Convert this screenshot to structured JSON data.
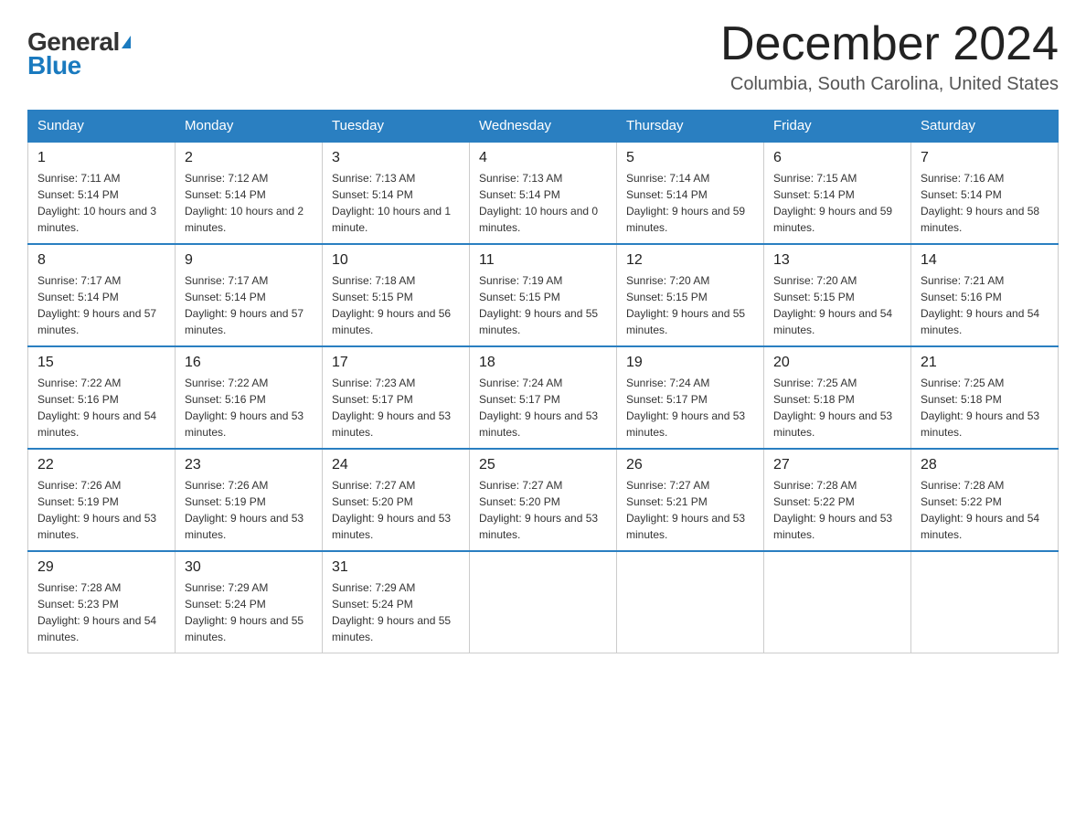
{
  "logo": {
    "general": "General",
    "blue": "Blue"
  },
  "header": {
    "title": "December 2024",
    "subtitle": "Columbia, South Carolina, United States"
  },
  "days_of_week": [
    "Sunday",
    "Monday",
    "Tuesday",
    "Wednesday",
    "Thursday",
    "Friday",
    "Saturday"
  ],
  "weeks": [
    [
      {
        "day": "1",
        "sunrise": "7:11 AM",
        "sunset": "5:14 PM",
        "daylight": "10 hours and 3 minutes."
      },
      {
        "day": "2",
        "sunrise": "7:12 AM",
        "sunset": "5:14 PM",
        "daylight": "10 hours and 2 minutes."
      },
      {
        "day": "3",
        "sunrise": "7:13 AM",
        "sunset": "5:14 PM",
        "daylight": "10 hours and 1 minute."
      },
      {
        "day": "4",
        "sunrise": "7:13 AM",
        "sunset": "5:14 PM",
        "daylight": "10 hours and 0 minutes."
      },
      {
        "day": "5",
        "sunrise": "7:14 AM",
        "sunset": "5:14 PM",
        "daylight": "9 hours and 59 minutes."
      },
      {
        "day": "6",
        "sunrise": "7:15 AM",
        "sunset": "5:14 PM",
        "daylight": "9 hours and 59 minutes."
      },
      {
        "day": "7",
        "sunrise": "7:16 AM",
        "sunset": "5:14 PM",
        "daylight": "9 hours and 58 minutes."
      }
    ],
    [
      {
        "day": "8",
        "sunrise": "7:17 AM",
        "sunset": "5:14 PM",
        "daylight": "9 hours and 57 minutes."
      },
      {
        "day": "9",
        "sunrise": "7:17 AM",
        "sunset": "5:14 PM",
        "daylight": "9 hours and 57 minutes."
      },
      {
        "day": "10",
        "sunrise": "7:18 AM",
        "sunset": "5:15 PM",
        "daylight": "9 hours and 56 minutes."
      },
      {
        "day": "11",
        "sunrise": "7:19 AM",
        "sunset": "5:15 PM",
        "daylight": "9 hours and 55 minutes."
      },
      {
        "day": "12",
        "sunrise": "7:20 AM",
        "sunset": "5:15 PM",
        "daylight": "9 hours and 55 minutes."
      },
      {
        "day": "13",
        "sunrise": "7:20 AM",
        "sunset": "5:15 PM",
        "daylight": "9 hours and 54 minutes."
      },
      {
        "day": "14",
        "sunrise": "7:21 AM",
        "sunset": "5:16 PM",
        "daylight": "9 hours and 54 minutes."
      }
    ],
    [
      {
        "day": "15",
        "sunrise": "7:22 AM",
        "sunset": "5:16 PM",
        "daylight": "9 hours and 54 minutes."
      },
      {
        "day": "16",
        "sunrise": "7:22 AM",
        "sunset": "5:16 PM",
        "daylight": "9 hours and 53 minutes."
      },
      {
        "day": "17",
        "sunrise": "7:23 AM",
        "sunset": "5:17 PM",
        "daylight": "9 hours and 53 minutes."
      },
      {
        "day": "18",
        "sunrise": "7:24 AM",
        "sunset": "5:17 PM",
        "daylight": "9 hours and 53 minutes."
      },
      {
        "day": "19",
        "sunrise": "7:24 AM",
        "sunset": "5:17 PM",
        "daylight": "9 hours and 53 minutes."
      },
      {
        "day": "20",
        "sunrise": "7:25 AM",
        "sunset": "5:18 PM",
        "daylight": "9 hours and 53 minutes."
      },
      {
        "day": "21",
        "sunrise": "7:25 AM",
        "sunset": "5:18 PM",
        "daylight": "9 hours and 53 minutes."
      }
    ],
    [
      {
        "day": "22",
        "sunrise": "7:26 AM",
        "sunset": "5:19 PM",
        "daylight": "9 hours and 53 minutes."
      },
      {
        "day": "23",
        "sunrise": "7:26 AM",
        "sunset": "5:19 PM",
        "daylight": "9 hours and 53 minutes."
      },
      {
        "day": "24",
        "sunrise": "7:27 AM",
        "sunset": "5:20 PM",
        "daylight": "9 hours and 53 minutes."
      },
      {
        "day": "25",
        "sunrise": "7:27 AM",
        "sunset": "5:20 PM",
        "daylight": "9 hours and 53 minutes."
      },
      {
        "day": "26",
        "sunrise": "7:27 AM",
        "sunset": "5:21 PM",
        "daylight": "9 hours and 53 minutes."
      },
      {
        "day": "27",
        "sunrise": "7:28 AM",
        "sunset": "5:22 PM",
        "daylight": "9 hours and 53 minutes."
      },
      {
        "day": "28",
        "sunrise": "7:28 AM",
        "sunset": "5:22 PM",
        "daylight": "9 hours and 54 minutes."
      }
    ],
    [
      {
        "day": "29",
        "sunrise": "7:28 AM",
        "sunset": "5:23 PM",
        "daylight": "9 hours and 54 minutes."
      },
      {
        "day": "30",
        "sunrise": "7:29 AM",
        "sunset": "5:24 PM",
        "daylight": "9 hours and 55 minutes."
      },
      {
        "day": "31",
        "sunrise": "7:29 AM",
        "sunset": "5:24 PM",
        "daylight": "9 hours and 55 minutes."
      },
      null,
      null,
      null,
      null
    ]
  ],
  "labels": {
    "sunrise": "Sunrise:",
    "sunset": "Sunset:",
    "daylight": "Daylight:"
  }
}
